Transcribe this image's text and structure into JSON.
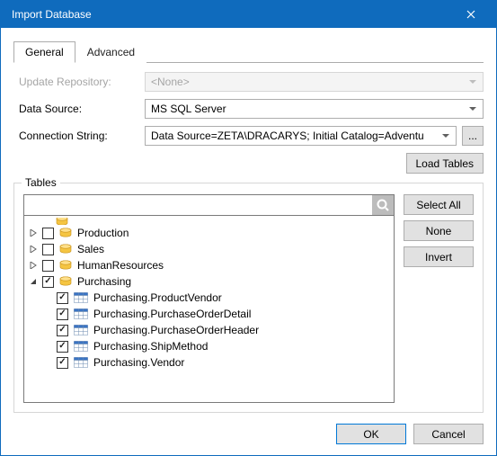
{
  "window": {
    "title": "Import Database"
  },
  "tabs": {
    "general": "General",
    "advanced": "Advanced"
  },
  "form": {
    "updateRepo": {
      "label": "Update Repository:",
      "value": "<None>"
    },
    "dataSource": {
      "label": "Data Source:",
      "value": "MS SQL Server"
    },
    "connString": {
      "label": "Connection String:",
      "value": "Data Source=ZETA\\DRACARYS; Initial Catalog=Adventu"
    },
    "connBrowse": "..."
  },
  "loadTables": "Load Tables",
  "tablesGroup": {
    "label": "Tables",
    "search": {
      "placeholder": ""
    },
    "selectAll": "Select All",
    "none": "None",
    "invert": "Invert",
    "schemas": [
      {
        "name": "Production",
        "checked": false,
        "expanded": false
      },
      {
        "name": "Sales",
        "checked": false,
        "expanded": false
      },
      {
        "name": "HumanResources",
        "checked": false,
        "expanded": false
      },
      {
        "name": "Purchasing",
        "checked": true,
        "expanded": true,
        "tables": [
          {
            "name": "Purchasing.ProductVendor",
            "checked": true
          },
          {
            "name": "Purchasing.PurchaseOrderDetail",
            "checked": true
          },
          {
            "name": "Purchasing.PurchaseOrderHeader",
            "checked": true
          },
          {
            "name": "Purchasing.ShipMethod",
            "checked": true
          },
          {
            "name": "Purchasing.Vendor",
            "checked": true
          }
        ]
      }
    ]
  },
  "footer": {
    "ok": "OK",
    "cancel": "Cancel"
  }
}
